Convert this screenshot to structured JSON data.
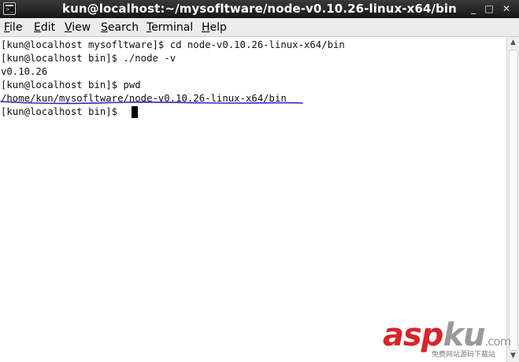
{
  "window": {
    "title": "kun@localhost:~/mysofltware/node-v0.10.26-linux-x64/bin",
    "icon": "terminal-icon",
    "controls": {
      "minimize": "_",
      "maximize": "□",
      "close": "✕"
    }
  },
  "menubar": {
    "items": [
      {
        "label": "File",
        "underline": "F"
      },
      {
        "label": "Edit",
        "underline": "E"
      },
      {
        "label": "View",
        "underline": "V"
      },
      {
        "label": "Search",
        "underline": "S"
      },
      {
        "label": "Terminal",
        "underline": "T"
      },
      {
        "label": "Help",
        "underline": "H"
      }
    ]
  },
  "terminal": {
    "lines": [
      "[kun@localhost mysofltware]$ cd node-v0.10.26-linux-x64/bin",
      "[kun@localhost bin]$ ./node -v",
      "v0.10.26",
      "[kun@localhost bin]$ pwd",
      "/home/kun/mysofltware/node-v0.10.26-linux-x64/bin",
      "[kun@localhost bin]$ "
    ],
    "annotation_color": "#2a2ac8"
  },
  "watermark": {
    "asp": "asp",
    "ku": "ku",
    "com": ".com",
    "subtitle": "免费网站源码下载站",
    "asp_color": "#d8232a",
    "ku_color": "#9a9a9a"
  }
}
